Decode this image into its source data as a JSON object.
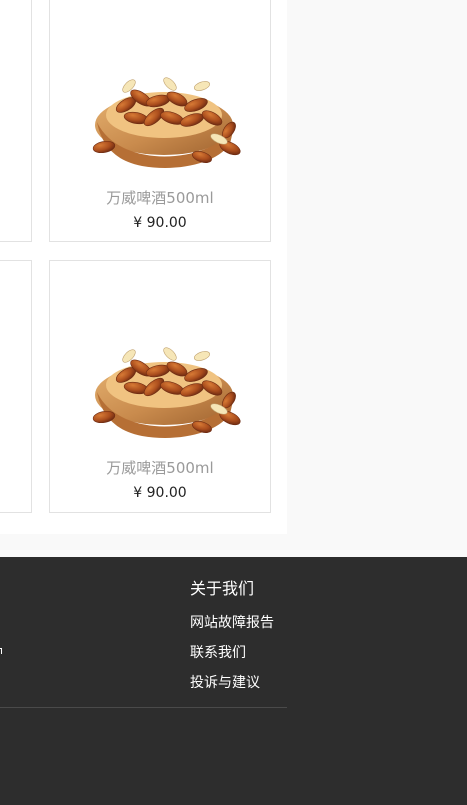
{
  "products": [
    {
      "name": "万威啤酒500ml",
      "price": "¥ 90.00",
      "image": "pine-nuts-bowl-image"
    },
    {
      "name": "万威啤酒500ml",
      "price": "¥ 90.00",
      "image": "pine-nuts-bowl-image"
    }
  ],
  "footer": {
    "about_title": "关于我们",
    "links": [
      "网站故障报告",
      "联系我们",
      "投诉与建议"
    ]
  },
  "colors": {
    "footer_background": "#2d2d2d",
    "product_name": "#9a9a9a",
    "price": "#222222",
    "border": "#e2e2e2"
  }
}
